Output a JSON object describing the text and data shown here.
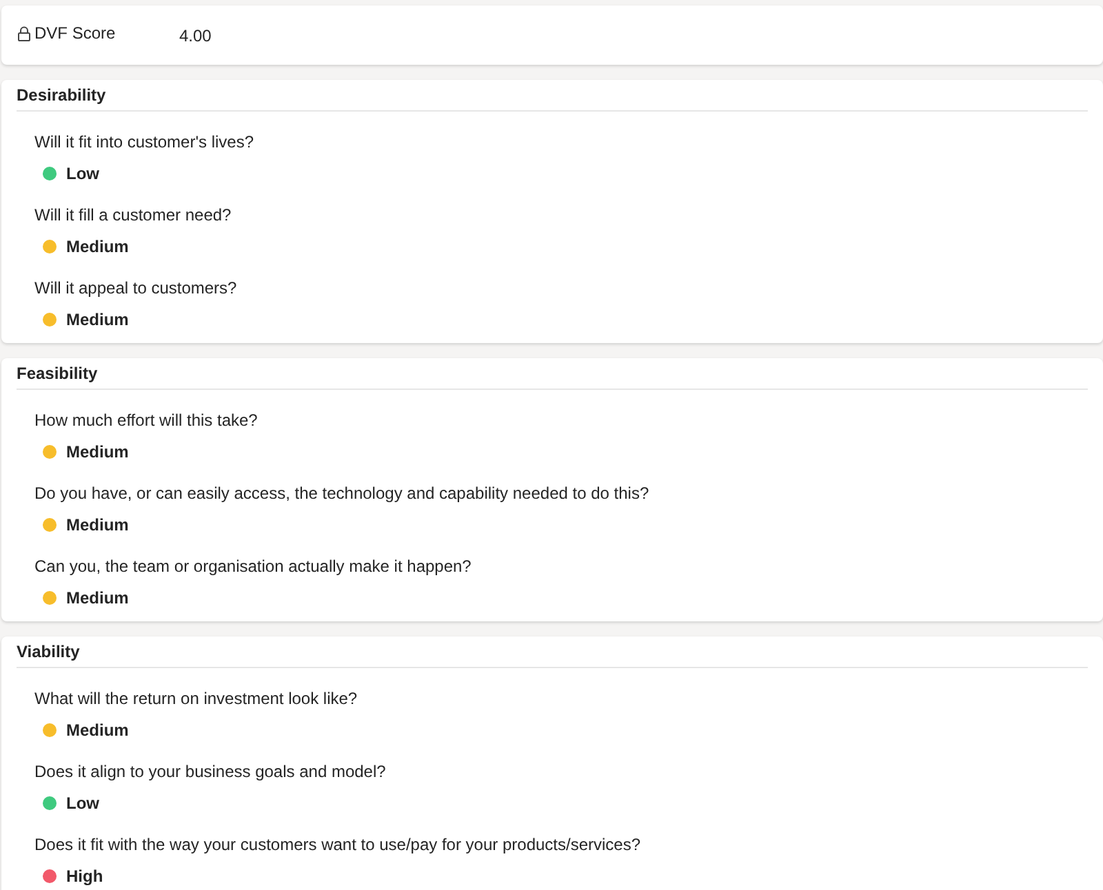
{
  "score": {
    "label": "DVF Score",
    "value": "4.00"
  },
  "sections": [
    {
      "title": "Desirability",
      "questions": [
        {
          "text": "Will it fit into customer's lives?",
          "answer": "Low",
          "color": "#3fca7f"
        },
        {
          "text": "Will it fill a customer need?",
          "answer": "Medium",
          "color": "#f7bd2b"
        },
        {
          "text": "Will it appeal to customers?",
          "answer": "Medium",
          "color": "#f7bd2b"
        }
      ]
    },
    {
      "title": "Feasibility",
      "questions": [
        {
          "text": "How much effort will this take?",
          "answer": "Medium",
          "color": "#f7bd2b"
        },
        {
          "text": "Do you have, or can easily access, the technology and capability needed to do this?",
          "answer": "Medium",
          "color": "#f7bd2b"
        },
        {
          "text": "Can you, the team or organisation actually make it happen?",
          "answer": "Medium",
          "color": "#f7bd2b"
        }
      ]
    },
    {
      "title": "Viability",
      "questions": [
        {
          "text": "What will the return on investment look like?",
          "answer": "Medium",
          "color": "#f7bd2b"
        },
        {
          "text": "Does it align to your business goals and model?",
          "answer": "Low",
          "color": "#3fca7f"
        },
        {
          "text": "Does it fit with the way your customers want to use/pay for your products/services?",
          "answer": "High",
          "color": "#f2596a"
        }
      ]
    }
  ]
}
